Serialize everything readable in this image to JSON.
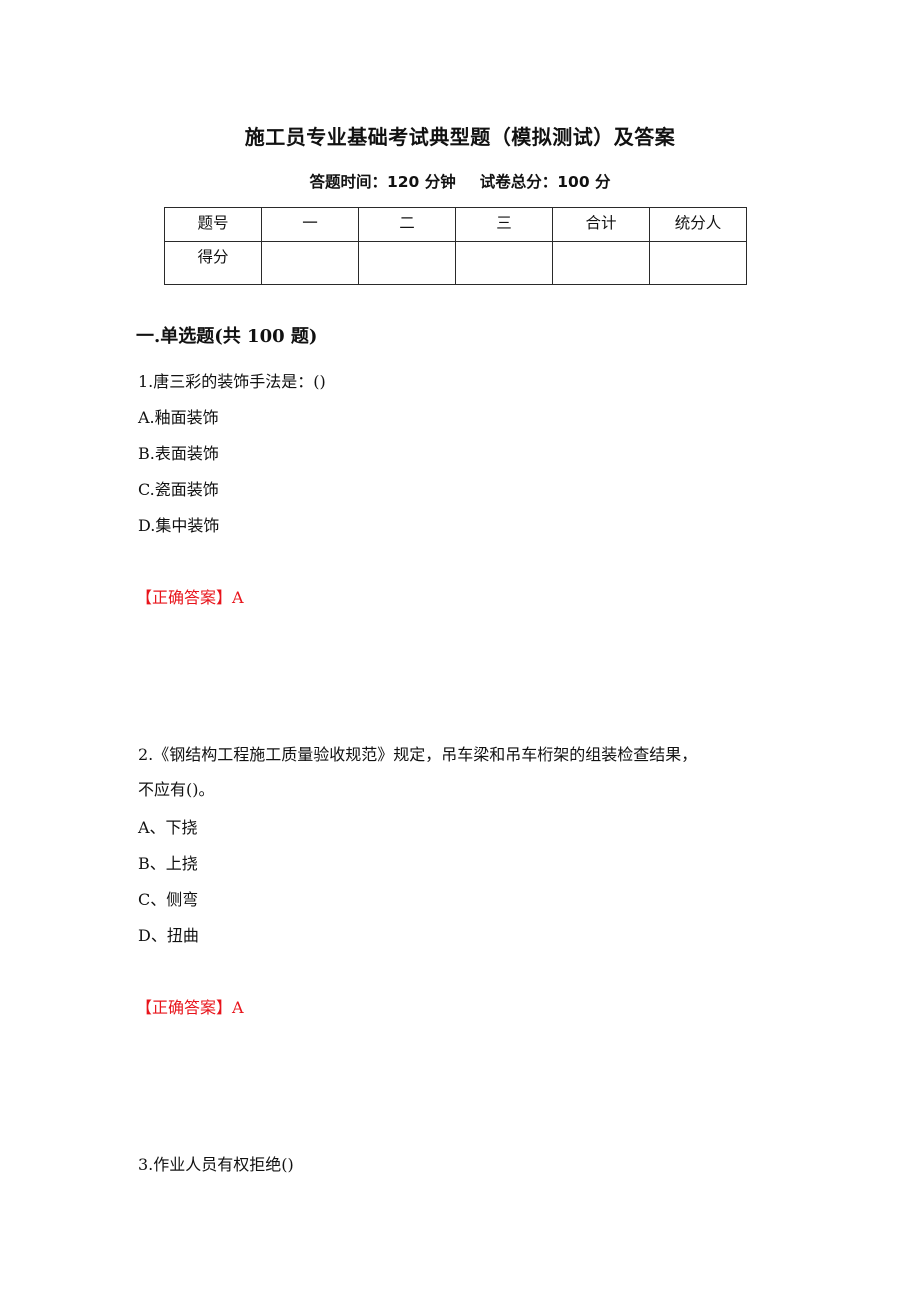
{
  "document": {
    "title": "施工员专业基础考试典型题（模拟测试）及答案",
    "meta": {
      "time_label": "答题时间：120 分钟",
      "score_label": "试卷总分：100 分"
    }
  },
  "score_table": {
    "header": [
      "题号",
      "一",
      "二",
      "三",
      "合计",
      "统分人"
    ],
    "row2": [
      "得分",
      "",
      "",
      "",
      "",
      ""
    ]
  },
  "section": {
    "heading": "一.单选题(共 100 题)"
  },
  "questions": [
    {
      "text": "1.唐三彩的装饰手法是：()",
      "options": [
        "A.釉面装饰",
        "B.表面装饰",
        "C.瓷面装饰",
        "D.集中装饰"
      ],
      "answer": "【正确答案】A"
    },
    {
      "text_line1": "2.《钢结构工程施工质量验收规范》规定，吊车梁和吊车桁架的组装检查结果，",
      "text_line2": "不应有()。",
      "options": [
        "A、下挠",
        "B、上挠",
        "C、侧弯",
        "D、扭曲"
      ],
      "answer": "【正确答案】A"
    },
    {
      "text": "3.作业人员有权拒绝()"
    }
  ],
  "colors": {
    "answer": "#e8141b",
    "text": "#111111",
    "table_border": "#2a2a2a"
  }
}
